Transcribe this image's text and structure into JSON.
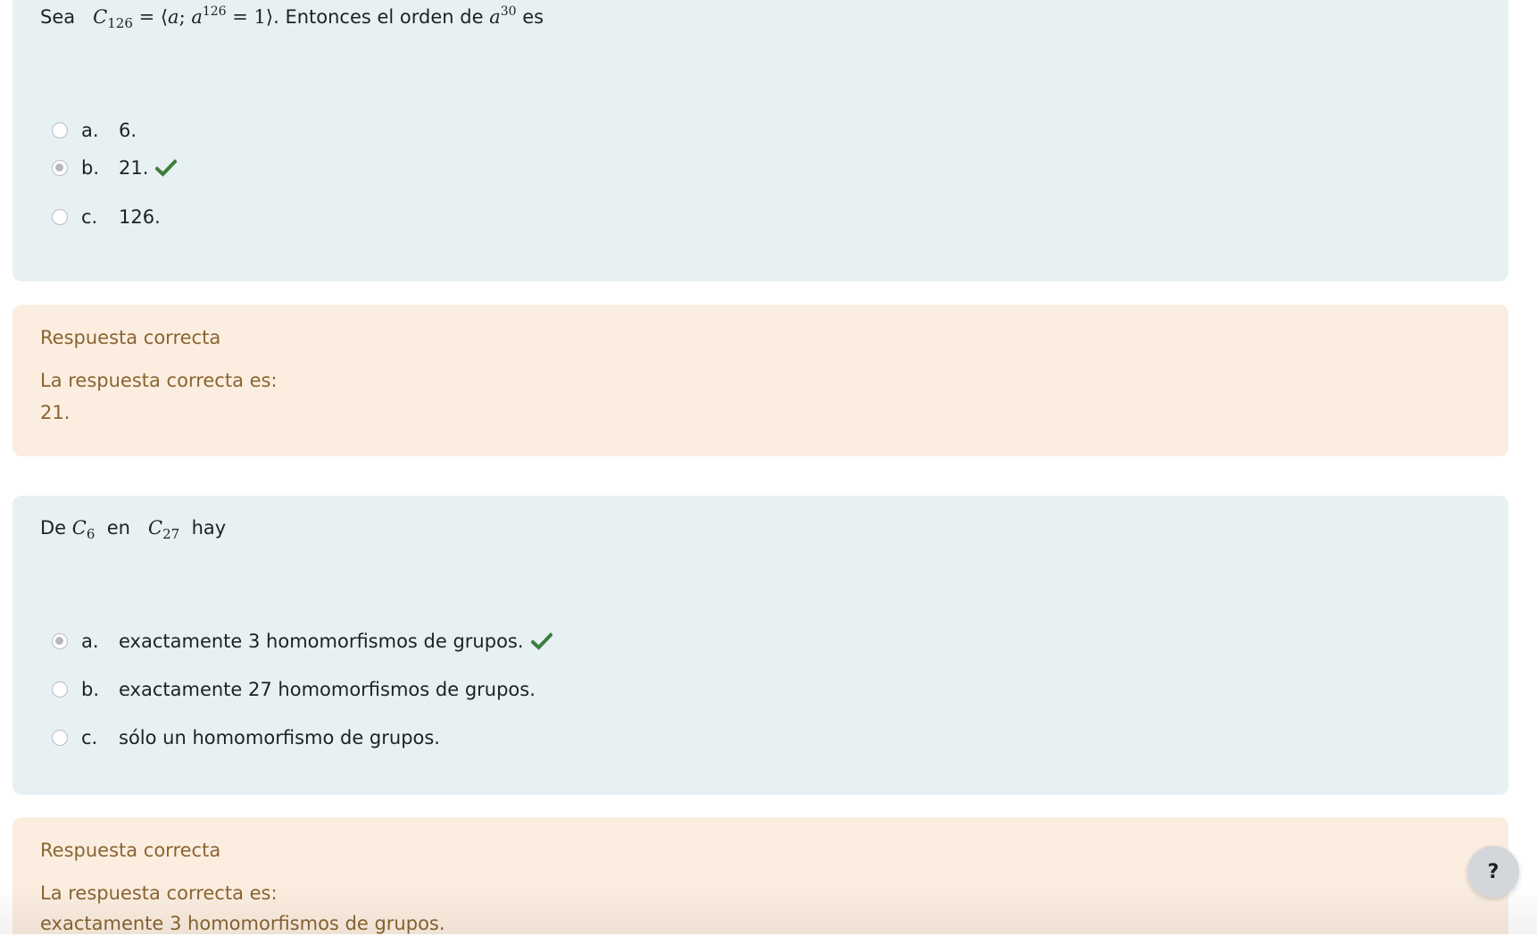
{
  "question1": {
    "text_prefix": "Sea",
    "math_C": "C",
    "math_C_sub": "126",
    "math_eq": "= ⟨",
    "math_a1": "a",
    "math_semi": "; ",
    "math_a2": "a",
    "math_a2_sup": "126",
    "math_eq2": " = 1⟩",
    "text_mid": ". Entonces el orden de",
    "math_a3": "a",
    "math_a3_sup": "30",
    "text_suffix": "es",
    "options": [
      {
        "letter": "a.",
        "text": "6.",
        "selected": false,
        "correct_mark": false
      },
      {
        "letter": "b.",
        "text": "21.",
        "selected": true,
        "correct_mark": true
      },
      {
        "letter": "c.",
        "text": "126.",
        "selected": false,
        "correct_mark": false
      }
    ]
  },
  "feedback1": {
    "status": "Respuesta correcta",
    "label": "La respuesta correcta es:",
    "answer": "21."
  },
  "question2": {
    "text_prefix": "De",
    "math_C1": "C",
    "math_C1_sub": "6",
    "text_mid": "en",
    "math_C2": "C",
    "math_C2_sub": "27",
    "text_suffix": "hay",
    "options": [
      {
        "letter": "a.",
        "text": "exactamente 3 homomorfismos de grupos.",
        "selected": true,
        "correct_mark": true
      },
      {
        "letter": "b.",
        "text": "exactamente 27 homomorfismos de grupos.",
        "selected": false,
        "correct_mark": false
      },
      {
        "letter": "c.",
        "text": "sólo un homomorfismo de grupos.",
        "selected": false,
        "correct_mark": false
      }
    ]
  },
  "feedback2": {
    "status": "Respuesta correcta",
    "label": "La respuesta correcta es:",
    "answer": "exactamente 3 homomorfismos de grupos."
  },
  "help_button": {
    "label": "?"
  },
  "colors": {
    "question_bg": "#e7f1f3",
    "feedback_bg": "#fbeee0",
    "feedback_text": "#8a6431",
    "check_green": "#3d7d3d"
  },
  "icons": {
    "correct": "check-icon",
    "help": "question-mark-icon"
  }
}
